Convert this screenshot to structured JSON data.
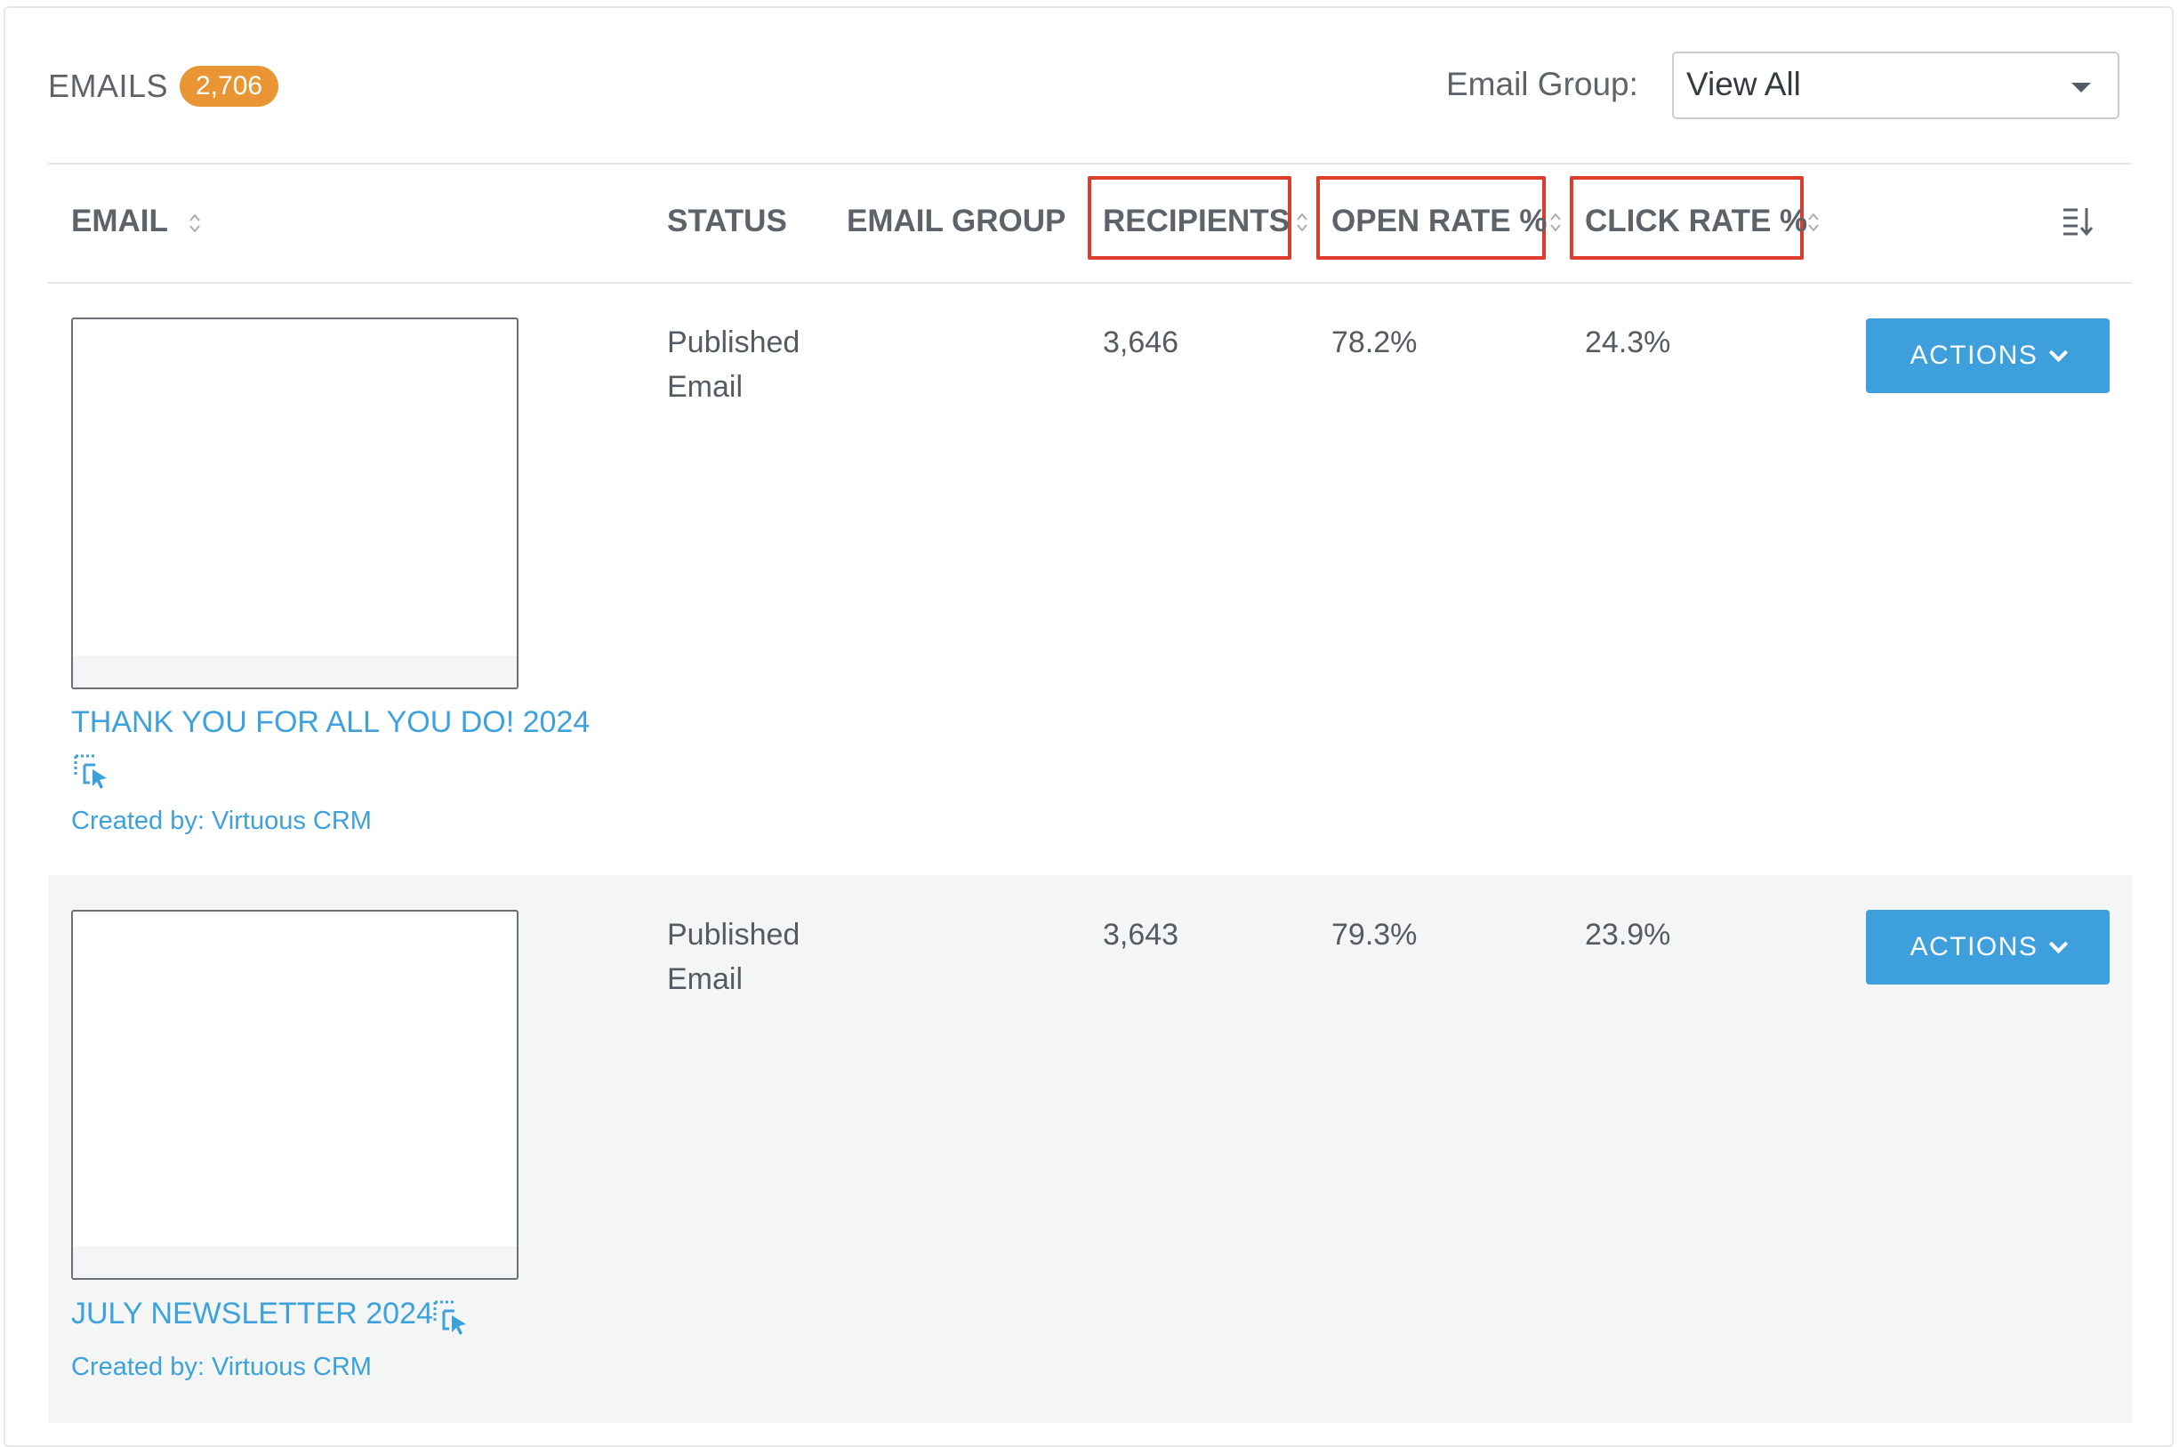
{
  "header": {
    "title": "EMAILS",
    "count": "2,706",
    "group_label": "Email Group:",
    "group_value": "View All"
  },
  "columns": {
    "email": "EMAIL",
    "status": "STATUS",
    "email_group": "EMAIL GROUP",
    "recipients": "RECIPIENTS",
    "open_rate": "OPEN RATE %",
    "click_rate": "CLICK RATE %"
  },
  "rows": [
    {
      "title": "THANK YOU FOR ALL YOU DO! 2024",
      "created_by": "Created by: Virtuous CRM",
      "status_line1": "Published",
      "status_line2": "Email",
      "email_group": "",
      "recipients": "3,646",
      "open_rate": "78.2%",
      "click_rate": "24.3%",
      "action_label": "ACTIONS"
    },
    {
      "title": "JULY NEWSLETTER 2024",
      "created_by": "Created by: Virtuous CRM",
      "status_line1": "Published",
      "status_line2": "Email",
      "email_group": "",
      "recipients": "3,643",
      "open_rate": "79.3%",
      "click_rate": "23.9%",
      "action_label": "ACTIONS"
    }
  ],
  "colors": {
    "accent": "#3d9fdc",
    "badge": "#e99534",
    "highlight": "#e03c2e"
  },
  "icons": {
    "sort": "sort-arrows-icon",
    "column_settings": "sort-lines-icon",
    "select": "select-cursor-icon",
    "dropdown": "caret-down-icon"
  }
}
